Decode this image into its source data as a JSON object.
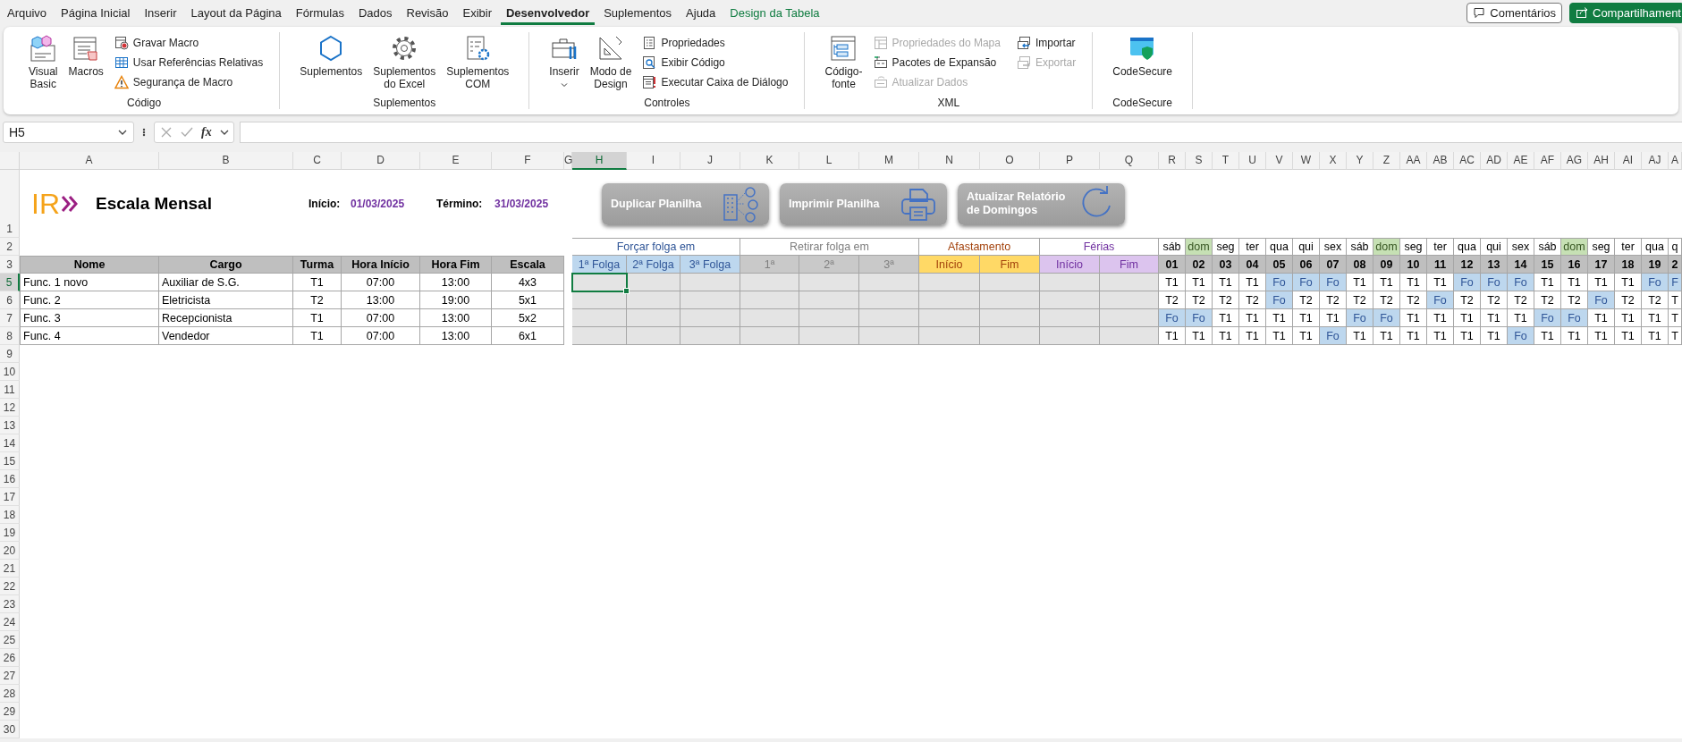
{
  "tabs": [
    {
      "label": "Arquivo",
      "selected": false,
      "kind": "normal"
    },
    {
      "label": "Página Inicial",
      "selected": false,
      "kind": "normal"
    },
    {
      "label": "Inserir",
      "selected": false,
      "kind": "normal"
    },
    {
      "label": "Layout da Página",
      "selected": false,
      "kind": "normal"
    },
    {
      "label": "Fórmulas",
      "selected": false,
      "kind": "normal"
    },
    {
      "label": "Dados",
      "selected": false,
      "kind": "normal"
    },
    {
      "label": "Revisão",
      "selected": false,
      "kind": "normal"
    },
    {
      "label": "Exibir",
      "selected": false,
      "kind": "normal"
    },
    {
      "label": "Desenvolvedor",
      "selected": true,
      "kind": "normal"
    },
    {
      "label": "Suplementos",
      "selected": false,
      "kind": "normal"
    },
    {
      "label": "Ajuda",
      "selected": false,
      "kind": "normal"
    },
    {
      "label": "Design da Tabela",
      "selected": false,
      "kind": "contextual"
    }
  ],
  "header_buttons": [
    {
      "label": "Comentários",
      "kind": "comments"
    },
    {
      "label": "Compartilhament",
      "kind": "share"
    }
  ],
  "ribbon_groups": [
    {
      "label": "Código",
      "items": [
        {
          "kind": "large",
          "lines": [
            "Visual",
            "Basic"
          ],
          "disabled": false,
          "dropdown": false
        },
        {
          "kind": "large",
          "lines": [
            "Macros"
          ],
          "disabled": false,
          "dropdown": false
        },
        {
          "kind": "small",
          "lines": [
            "Gravar Macro"
          ],
          "disabled": false,
          "dropdown": false
        },
        {
          "kind": "small",
          "lines": [
            "Usar Referências Relativas"
          ],
          "disabled": false,
          "dropdown": false
        },
        {
          "kind": "small",
          "lines": [
            "Segurança de Macro"
          ],
          "disabled": false,
          "dropdown": false
        }
      ]
    },
    {
      "label": "Suplementos",
      "items": [
        {
          "kind": "large",
          "lines": [
            "Suplementos"
          ],
          "disabled": false,
          "dropdown": false
        },
        {
          "kind": "large",
          "lines": [
            "Suplementos",
            "do Excel"
          ],
          "disabled": false,
          "dropdown": false
        },
        {
          "kind": "large",
          "lines": [
            "Suplementos",
            "COM"
          ],
          "disabled": false,
          "dropdown": false
        }
      ]
    },
    {
      "label": "Controles",
      "items": [
        {
          "kind": "large",
          "lines": [
            "Inserir"
          ],
          "disabled": false,
          "dropdown": true
        },
        {
          "kind": "large",
          "lines": [
            "Modo de",
            "Design"
          ],
          "disabled": false,
          "dropdown": false
        },
        {
          "kind": "small",
          "lines": [
            "Propriedades"
          ],
          "disabled": false,
          "dropdown": false
        },
        {
          "kind": "small",
          "lines": [
            "Exibir Código"
          ],
          "disabled": false,
          "dropdown": false
        },
        {
          "kind": "small",
          "lines": [
            "Executar Caixa de Diálogo"
          ],
          "disabled": false,
          "dropdown": false
        }
      ]
    },
    {
      "label": "XML",
      "items": [
        {
          "kind": "large",
          "lines": [
            "Código-",
            "fonte"
          ],
          "disabled": false,
          "dropdown": false
        },
        {
          "kind": "small",
          "lines": [
            "Propriedades do Mapa"
          ],
          "disabled": true,
          "dropdown": false
        },
        {
          "kind": "small",
          "lines": [
            "Pacotes de Expansão"
          ],
          "disabled": false,
          "dropdown": false
        },
        {
          "kind": "small",
          "lines": [
            "Atualizar Dados"
          ],
          "disabled": true,
          "dropdown": false
        },
        {
          "kind": "small",
          "lines": [
            "Importar"
          ],
          "disabled": false,
          "dropdown": false
        },
        {
          "kind": "small",
          "lines": [
            "Exportar"
          ],
          "disabled": true,
          "dropdown": false
        }
      ]
    },
    {
      "label": "CodeSecure",
      "items": [
        {
          "kind": "large",
          "lines": [
            "CodeSecure"
          ],
          "disabled": false,
          "dropdown": false
        }
      ]
    }
  ],
  "formula_bar": {
    "name_box": "H5",
    "function_label": "fx"
  },
  "sheet": {
    "columns": [
      {
        "label": "A",
        "selected": false
      },
      {
        "label": "B",
        "selected": false
      },
      {
        "label": "C",
        "selected": false
      },
      {
        "label": "D",
        "selected": false
      },
      {
        "label": "E",
        "selected": false
      },
      {
        "label": "F",
        "selected": false
      },
      {
        "label": "G",
        "selected": false
      },
      {
        "label": "H",
        "selected": true
      },
      {
        "label": "I",
        "selected": false
      },
      {
        "label": "J",
        "selected": false
      },
      {
        "label": "K",
        "selected": false
      },
      {
        "label": "L",
        "selected": false
      },
      {
        "label": "M",
        "selected": false
      },
      {
        "label": "N",
        "selected": false
      },
      {
        "label": "O",
        "selected": false
      },
      {
        "label": "P",
        "selected": false
      },
      {
        "label": "Q",
        "selected": false
      },
      {
        "label": "R",
        "selected": false
      },
      {
        "label": "S",
        "selected": false
      },
      {
        "label": "T",
        "selected": false
      },
      {
        "label": "U",
        "selected": false
      },
      {
        "label": "V",
        "selected": false
      },
      {
        "label": "W",
        "selected": false
      },
      {
        "label": "X",
        "selected": false
      },
      {
        "label": "Y",
        "selected": false
      },
      {
        "label": "Z",
        "selected": false
      },
      {
        "label": "AA",
        "selected": false
      },
      {
        "label": "AB",
        "selected": false
      },
      {
        "label": "AC",
        "selected": false
      },
      {
        "label": "AD",
        "selected": false
      },
      {
        "label": "AE",
        "selected": false
      },
      {
        "label": "AF",
        "selected": false
      },
      {
        "label": "AG",
        "selected": false
      },
      {
        "label": "AH",
        "selected": false
      },
      {
        "label": "AI",
        "selected": false
      },
      {
        "label": "AJ",
        "selected": false
      },
      {
        "label": "A",
        "selected": false
      }
    ],
    "rows": [
      {
        "label": "1",
        "selected": false
      },
      {
        "label": "2",
        "selected": false
      },
      {
        "label": "3",
        "selected": false
      },
      {
        "label": "5",
        "selected": true
      },
      {
        "label": "6",
        "selected": false
      },
      {
        "label": "7",
        "selected": false
      },
      {
        "label": "8",
        "selected": false
      },
      {
        "label": "9",
        "selected": false
      },
      {
        "label": "10",
        "selected": false
      },
      {
        "label": "11",
        "selected": false
      },
      {
        "label": "12",
        "selected": false
      },
      {
        "label": "13",
        "selected": false
      },
      {
        "label": "14",
        "selected": false
      },
      {
        "label": "15",
        "selected": false
      },
      {
        "label": "16",
        "selected": false
      },
      {
        "label": "17",
        "selected": false
      },
      {
        "label": "18",
        "selected": false
      },
      {
        "label": "19",
        "selected": false
      },
      {
        "label": "20",
        "selected": false
      },
      {
        "label": "21",
        "selected": false
      },
      {
        "label": "22",
        "selected": false
      },
      {
        "label": "23",
        "selected": false
      },
      {
        "label": "24",
        "selected": false
      },
      {
        "label": "25",
        "selected": false
      },
      {
        "label": "26",
        "selected": false
      },
      {
        "label": "27",
        "selected": false
      },
      {
        "label": "28",
        "selected": false
      },
      {
        "label": "29",
        "selected": false
      },
      {
        "label": "30",
        "selected": false
      }
    ],
    "logo": "IR",
    "title": "Escala Mensal",
    "start_label": "Início:",
    "start_date": "01/03/2025",
    "end_label": "Término:",
    "end_date": "31/03/2025",
    "buttons": [
      {
        "lines": [
          "Duplicar Planilha"
        ],
        "kind": "duplicate"
      },
      {
        "lines": [
          "Imprimir Planilha"
        ],
        "kind": "print"
      },
      {
        "lines": [
          "Atualizar Relatório",
          "de Domingos"
        ],
        "kind": "refresh"
      }
    ],
    "table_headers": [
      "Nome",
      "Cargo",
      "Turma",
      "Hora Início",
      "Hora Fim",
      "Escala"
    ],
    "groups": [
      {
        "label": "Forçar folga em",
        "color": "#2f5597",
        "headers": [
          {
            "label": "1ª Folga",
            "color": "#bdd7ee"
          },
          {
            "label": "2ª Folga",
            "color": "#bdd7ee"
          },
          {
            "label": "3ª Folga",
            "color": "#bdd7ee"
          }
        ]
      },
      {
        "label": "Retirar folga em",
        "color": "#7f7f7f",
        "headers": [
          {
            "label": "1ª",
            "color": "#c9c9c9"
          },
          {
            "label": "2ª",
            "color": "#c9c9c9"
          },
          {
            "label": "3ª",
            "color": "#c9c9c9"
          }
        ]
      },
      {
        "label": "Afastamento",
        "color": "#a3420c",
        "headers": [
          {
            "label": "Início",
            "color": "#ffd966"
          },
          {
            "label": "Fim",
            "color": "#ffd966"
          }
        ]
      },
      {
        "label": "Férias",
        "color": "#7030a0",
        "headers": [
          {
            "label": "Início",
            "color": "#dcc4ee"
          },
          {
            "label": "Fim",
            "color": "#dcc4ee"
          }
        ]
      }
    ],
    "days": [
      {
        "weekday": "sáb",
        "date": "01",
        "sunday": false
      },
      {
        "weekday": "dom",
        "date": "02",
        "sunday": true
      },
      {
        "weekday": "seg",
        "date": "03",
        "sunday": false
      },
      {
        "weekday": "ter",
        "date": "04",
        "sunday": false
      },
      {
        "weekday": "qua",
        "date": "05",
        "sunday": false
      },
      {
        "weekday": "qui",
        "date": "06",
        "sunday": false
      },
      {
        "weekday": "sex",
        "date": "07",
        "sunday": false
      },
      {
        "weekday": "sáb",
        "date": "08",
        "sunday": false
      },
      {
        "weekday": "dom",
        "date": "09",
        "sunday": true
      },
      {
        "weekday": "seg",
        "date": "10",
        "sunday": false
      },
      {
        "weekday": "ter",
        "date": "11",
        "sunday": false
      },
      {
        "weekday": "qua",
        "date": "12",
        "sunday": false
      },
      {
        "weekday": "qui",
        "date": "13",
        "sunday": false
      },
      {
        "weekday": "sex",
        "date": "14",
        "sunday": false
      },
      {
        "weekday": "sáb",
        "date": "15",
        "sunday": false
      },
      {
        "weekday": "dom",
        "date": "16",
        "sunday": true
      },
      {
        "weekday": "seg",
        "date": "17",
        "sunday": false
      },
      {
        "weekday": "ter",
        "date": "18",
        "sunday": false
      },
      {
        "weekday": "qua",
        "date": "19",
        "sunday": false
      },
      {
        "weekday": "q",
        "date": "2",
        "sunday": false
      }
    ],
    "employees": [
      {
        "name": "Func. 1 novo",
        "cargo": "Auxiliar de S.G.",
        "turma": "T1",
        "hora_inicio": "07:00",
        "hora_fim": "13:00",
        "escala": "4x3",
        "shifts": [
          {
            "value": "T1",
            "off": false
          },
          {
            "value": "T1",
            "off": false
          },
          {
            "value": "T1",
            "off": false
          },
          {
            "value": "T1",
            "off": false
          },
          {
            "value": "Fo",
            "off": true
          },
          {
            "value": "Fo",
            "off": true
          },
          {
            "value": "Fo",
            "off": true
          },
          {
            "value": "T1",
            "off": false
          },
          {
            "value": "T1",
            "off": false
          },
          {
            "value": "T1",
            "off": false
          },
          {
            "value": "T1",
            "off": false
          },
          {
            "value": "Fo",
            "off": true
          },
          {
            "value": "Fo",
            "off": true
          },
          {
            "value": "Fo",
            "off": true
          },
          {
            "value": "T1",
            "off": false
          },
          {
            "value": "T1",
            "off": false
          },
          {
            "value": "T1",
            "off": false
          },
          {
            "value": "T1",
            "off": false
          },
          {
            "value": "Fo",
            "off": true
          },
          {
            "value": "F",
            "off": true
          }
        ]
      },
      {
        "name": "Func. 2",
        "cargo": "Eletricista",
        "turma": "T2",
        "hora_inicio": "13:00",
        "hora_fim": "19:00",
        "escala": "5x1",
        "shifts": [
          {
            "value": "T2",
            "off": false
          },
          {
            "value": "T2",
            "off": false
          },
          {
            "value": "T2",
            "off": false
          },
          {
            "value": "T2",
            "off": false
          },
          {
            "value": "Fo",
            "off": true
          },
          {
            "value": "T2",
            "off": false
          },
          {
            "value": "T2",
            "off": false
          },
          {
            "value": "T2",
            "off": false
          },
          {
            "value": "T2",
            "off": false
          },
          {
            "value": "T2",
            "off": false
          },
          {
            "value": "Fo",
            "off": true
          },
          {
            "value": "T2",
            "off": false
          },
          {
            "value": "T2",
            "off": false
          },
          {
            "value": "T2",
            "off": false
          },
          {
            "value": "T2",
            "off": false
          },
          {
            "value": "T2",
            "off": false
          },
          {
            "value": "Fo",
            "off": true
          },
          {
            "value": "T2",
            "off": false
          },
          {
            "value": "T2",
            "off": false
          },
          {
            "value": "T",
            "off": false
          }
        ]
      },
      {
        "name": "Func. 3",
        "cargo": "Recepcionista",
        "turma": "T1",
        "hora_inicio": "07:00",
        "hora_fim": "13:00",
        "escala": "5x2",
        "shifts": [
          {
            "value": "Fo",
            "off": true
          },
          {
            "value": "Fo",
            "off": true
          },
          {
            "value": "T1",
            "off": false
          },
          {
            "value": "T1",
            "off": false
          },
          {
            "value": "T1",
            "off": false
          },
          {
            "value": "T1",
            "off": false
          },
          {
            "value": "T1",
            "off": false
          },
          {
            "value": "Fo",
            "off": true
          },
          {
            "value": "Fo",
            "off": true
          },
          {
            "value": "T1",
            "off": false
          },
          {
            "value": "T1",
            "off": false
          },
          {
            "value": "T1",
            "off": false
          },
          {
            "value": "T1",
            "off": false
          },
          {
            "value": "T1",
            "off": false
          },
          {
            "value": "Fo",
            "off": true
          },
          {
            "value": "Fo",
            "off": true
          },
          {
            "value": "T1",
            "off": false
          },
          {
            "value": "T1",
            "off": false
          },
          {
            "value": "T1",
            "off": false
          },
          {
            "value": "T",
            "off": false
          }
        ]
      },
      {
        "name": "Func. 4",
        "cargo": "Vendedor",
        "turma": "T1",
        "hora_inicio": "07:00",
        "hora_fim": "13:00",
        "escala": "6x1",
        "shifts": [
          {
            "value": "T1",
            "off": false
          },
          {
            "value": "T1",
            "off": false
          },
          {
            "value": "T1",
            "off": false
          },
          {
            "value": "T1",
            "off": false
          },
          {
            "value": "T1",
            "off": false
          },
          {
            "value": "T1",
            "off": false
          },
          {
            "value": "Fo",
            "off": true
          },
          {
            "value": "T1",
            "off": false
          },
          {
            "value": "T1",
            "off": false
          },
          {
            "value": "T1",
            "off": false
          },
          {
            "value": "T1",
            "off": false
          },
          {
            "value": "T1",
            "off": false
          },
          {
            "value": "T1",
            "off": false
          },
          {
            "value": "Fo",
            "off": true
          },
          {
            "value": "T1",
            "off": false
          },
          {
            "value": "T1",
            "off": false
          },
          {
            "value": "T1",
            "off": false
          },
          {
            "value": "T1",
            "off": false
          },
          {
            "value": "T1",
            "off": false
          },
          {
            "value": "T",
            "off": false
          }
        ]
      }
    ]
  }
}
